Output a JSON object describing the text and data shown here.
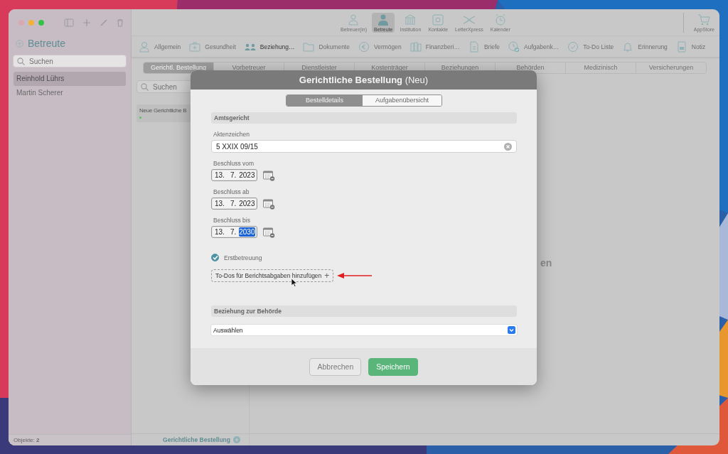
{
  "sidebar": {
    "title": "Betreute",
    "search": {
      "placeholder": "Suchen"
    },
    "items": [
      {
        "label": "Reinhold Lührs",
        "selected": true
      },
      {
        "label": "Martin Scherer",
        "selected": false
      }
    ],
    "footer": "Objekte: **2**"
  },
  "toolbar": {
    "items": [
      {
        "label": "Betreuer(in)",
        "selected": false
      },
      {
        "label": "Betreute",
        "selected": true
      },
      {
        "label": "Institution",
        "selected": false
      },
      {
        "label": "Kontakte",
        "selected": false
      },
      {
        "label": "LetterXpress",
        "selected": false
      },
      {
        "label": "Kalender",
        "selected": false
      }
    ],
    "appstore": "AppStore"
  },
  "sections_bar": [
    {
      "label": "Allgemein",
      "selected": false
    },
    {
      "label": "Gesundheit",
      "selected": false
    },
    {
      "label": "Beziehung…",
      "selected": true
    },
    {
      "label": "Dokumente",
      "selected": false
    },
    {
      "label": "Vermögen",
      "selected": false
    },
    {
      "label": "Finanzberi…",
      "selected": false
    },
    {
      "label": "Briefe",
      "selected": false
    },
    {
      "label": "Aufgabenk…",
      "selected": false
    },
    {
      "label": "To-Do Liste",
      "selected": false
    },
    {
      "label": "Erinnerung",
      "selected": false
    },
    {
      "label": "Notiz",
      "selected": false
    }
  ],
  "tabs": [
    {
      "label": "Gerichtl. Bestellung",
      "selected": true
    },
    {
      "label": "Vorbetreuer",
      "selected": false
    },
    {
      "label": "Dienstleister",
      "selected": false
    },
    {
      "label": "Kostenträger",
      "selected": false
    },
    {
      "label": "Beziehungen",
      "selected": false
    },
    {
      "label": "Behörden",
      "selected": false
    },
    {
      "label": "Medizinisch",
      "selected": false
    },
    {
      "label": "Versicherungen",
      "selected": false
    }
  ],
  "list": {
    "search": {
      "placeholder": "Suchen"
    },
    "items": [
      {
        "label": "Neue Gerichtliche B",
        "color": "#5cc26a"
      }
    ],
    "footer": "Gerichtliche Bestellung"
  },
  "main": {
    "text": "en"
  },
  "dialog": {
    "title": "**Gerichtliche Bestellung** (Neu)",
    "segments": [
      {
        "label": "Bestelldetails",
        "selected": true
      },
      {
        "label": "Aufgabenübersicht",
        "selected": false
      }
    ],
    "form": [
      {
        "kind": "section",
        "label": "Amtsgericht"
      },
      {
        "kind": "text",
        "label": "Aktenzeichen",
        "value": "5 XXIX 09/15"
      },
      {
        "kind": "date",
        "label": "Beschluss vom",
        "parts": [
          {
            "text": "13.",
            "selected": false
          },
          {
            "text": "7.",
            "selected": false
          },
          {
            "text": "2023",
            "selected": false
          }
        ]
      },
      {
        "kind": "date",
        "label": "Beschluss ab",
        "parts": [
          {
            "text": "13.",
            "selected": false
          },
          {
            "text": "7.",
            "selected": false
          },
          {
            "text": "2023",
            "selected": false
          }
        ]
      },
      {
        "kind": "date",
        "label": "Beschluss bis",
        "parts": [
          {
            "text": "13.",
            "selected": false
          },
          {
            "text": "7.",
            "selected": false
          },
          {
            "text": "2030",
            "selected": true
          }
        ]
      },
      {
        "kind": "checkbox",
        "label": "Erstbetreuung",
        "checked": true
      },
      {
        "kind": "add_button",
        "label": "To-Dos für Berichtsabgaben hinzufügen",
        "icon": "+"
      },
      {
        "kind": "section",
        "label": "Beziehung zur Behörde"
      },
      {
        "kind": "select",
        "value": "Auswählen"
      }
    ],
    "buttons": [
      {
        "label": "Abbrechen",
        "kind": "secondary"
      },
      {
        "label": "Speichern",
        "kind": "primary"
      }
    ]
  }
}
